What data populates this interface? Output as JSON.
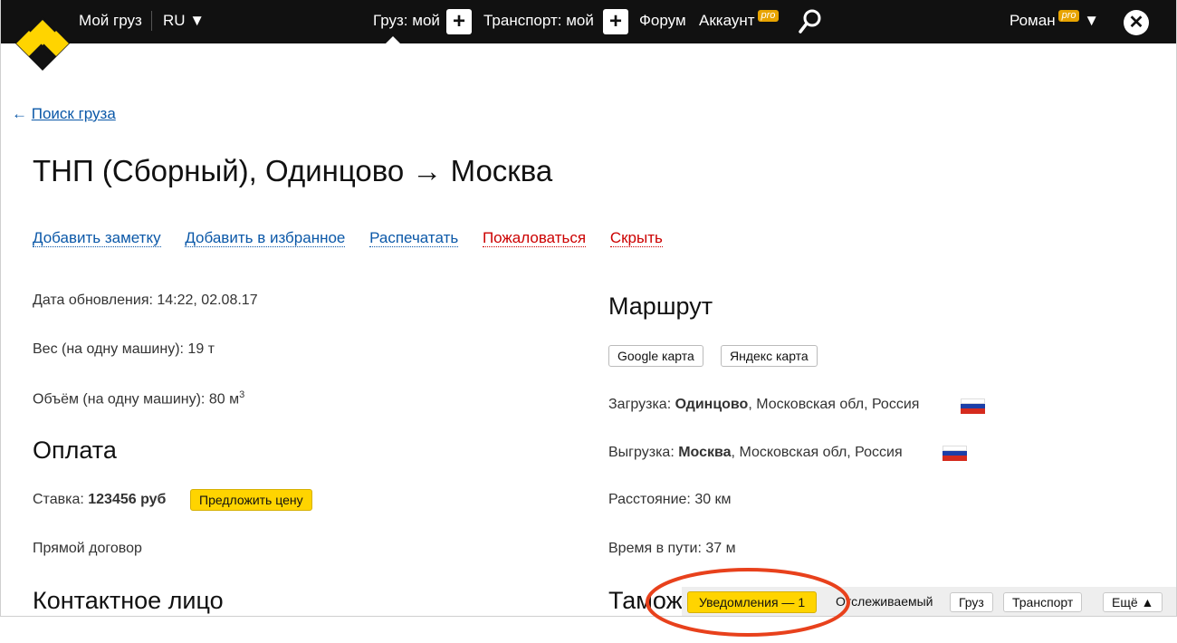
{
  "topbar": {
    "my_cargo": "Мой груз",
    "lang": "RU ▼",
    "cargo_mine": "Груз: мой",
    "transport_mine": "Транспорт: мой",
    "forum": "Форум",
    "account": "Аккаунт",
    "pro_badge": "pro",
    "user": "Роман",
    "user_caret": "▼",
    "plus": "+",
    "close": "✕"
  },
  "back_link": {
    "arrow": "←",
    "label": "Поиск груза"
  },
  "page_title": "ТНП (Сборный), Одинцово → Москва",
  "actions": {
    "add_note": "Добавить заметку",
    "add_favorite": "Добавить в избранное",
    "print": "Распечатать",
    "complain": "Пожаловаться",
    "hide": "Скрыть"
  },
  "details": {
    "updated_label": "Дата обновления:",
    "updated_value": "14:22, 02.08.17",
    "weight_label": "Вес (на одну машину):",
    "weight_value": "19 т",
    "volume_label": "Объём (на одну машину):",
    "volume_value": "80 м",
    "volume_sup": "3"
  },
  "payment": {
    "heading": "Оплата",
    "rate_label": "Ставка:",
    "rate_value": "123456 руб",
    "offer_button": "Предложить цену",
    "contract": "Прямой договор"
  },
  "contact": {
    "heading": "Контактное лицо"
  },
  "route": {
    "heading": "Маршрут",
    "google_button": "Google карта",
    "yandex_button": "Яндекс карта",
    "load_label": "Загрузка:",
    "load_city": "Одинцово",
    "load_rest": ", Московская обл, Россия",
    "unload_label": "Выгрузка:",
    "unload_city": "Москва",
    "unload_rest": ", Московская обл, Россия",
    "distance": "Расстояние: 30 км",
    "travel_time": "Время в пути: 37 м"
  },
  "customs": {
    "heading_partial": "Тамож"
  },
  "bottombar": {
    "notifications": "Уведомления — 1",
    "tracked": "Отслеживаемый",
    "cargo": "Груз",
    "transport": "Транспорт",
    "more": "Ещё ▲"
  },
  "colors": {
    "accent_yellow": "#ffd400",
    "link_blue": "#0b58a8",
    "link_red": "#cc0000",
    "highlight": "#e8411c"
  }
}
